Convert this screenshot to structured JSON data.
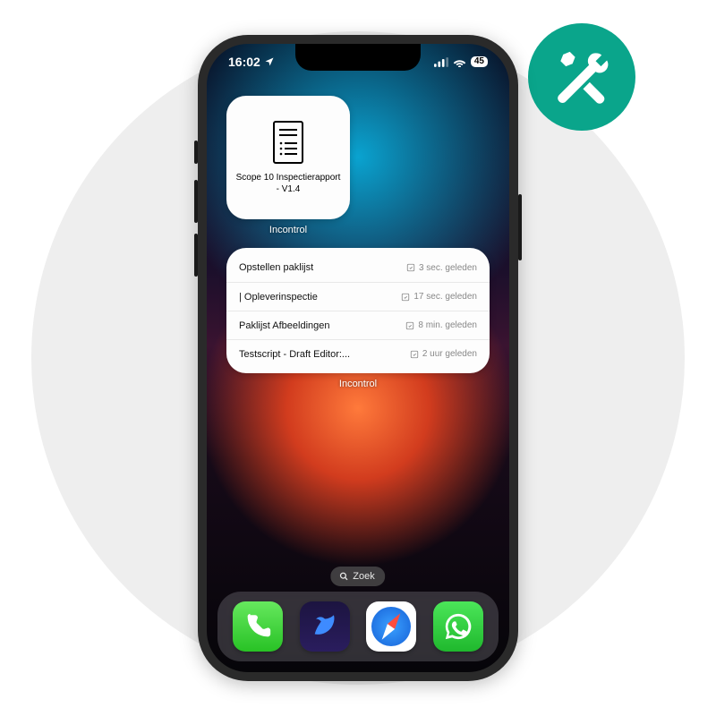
{
  "status": {
    "time": "16:02",
    "battery": "45"
  },
  "widget_small": {
    "title": "Scope 10 Inspectierapport - V1.4",
    "caption": "Incontrol"
  },
  "widget_list": {
    "items": [
      {
        "title": "Opstellen paklijst",
        "time": "3 sec. geleden"
      },
      {
        "title": "| Opleverinspectie",
        "time": "17 sec. geleden"
      },
      {
        "title": "Paklijst Afbeeldingen",
        "time": "8 min. geleden"
      },
      {
        "title": "Testscript - Draft Editor:...",
        "time": "2 uur geleden"
      }
    ],
    "caption": "Incontrol"
  },
  "search_label": "Zoek",
  "dock": {
    "phone": "Phone",
    "app2": "App",
    "safari": "Safari",
    "whatsapp": "WhatsApp"
  }
}
